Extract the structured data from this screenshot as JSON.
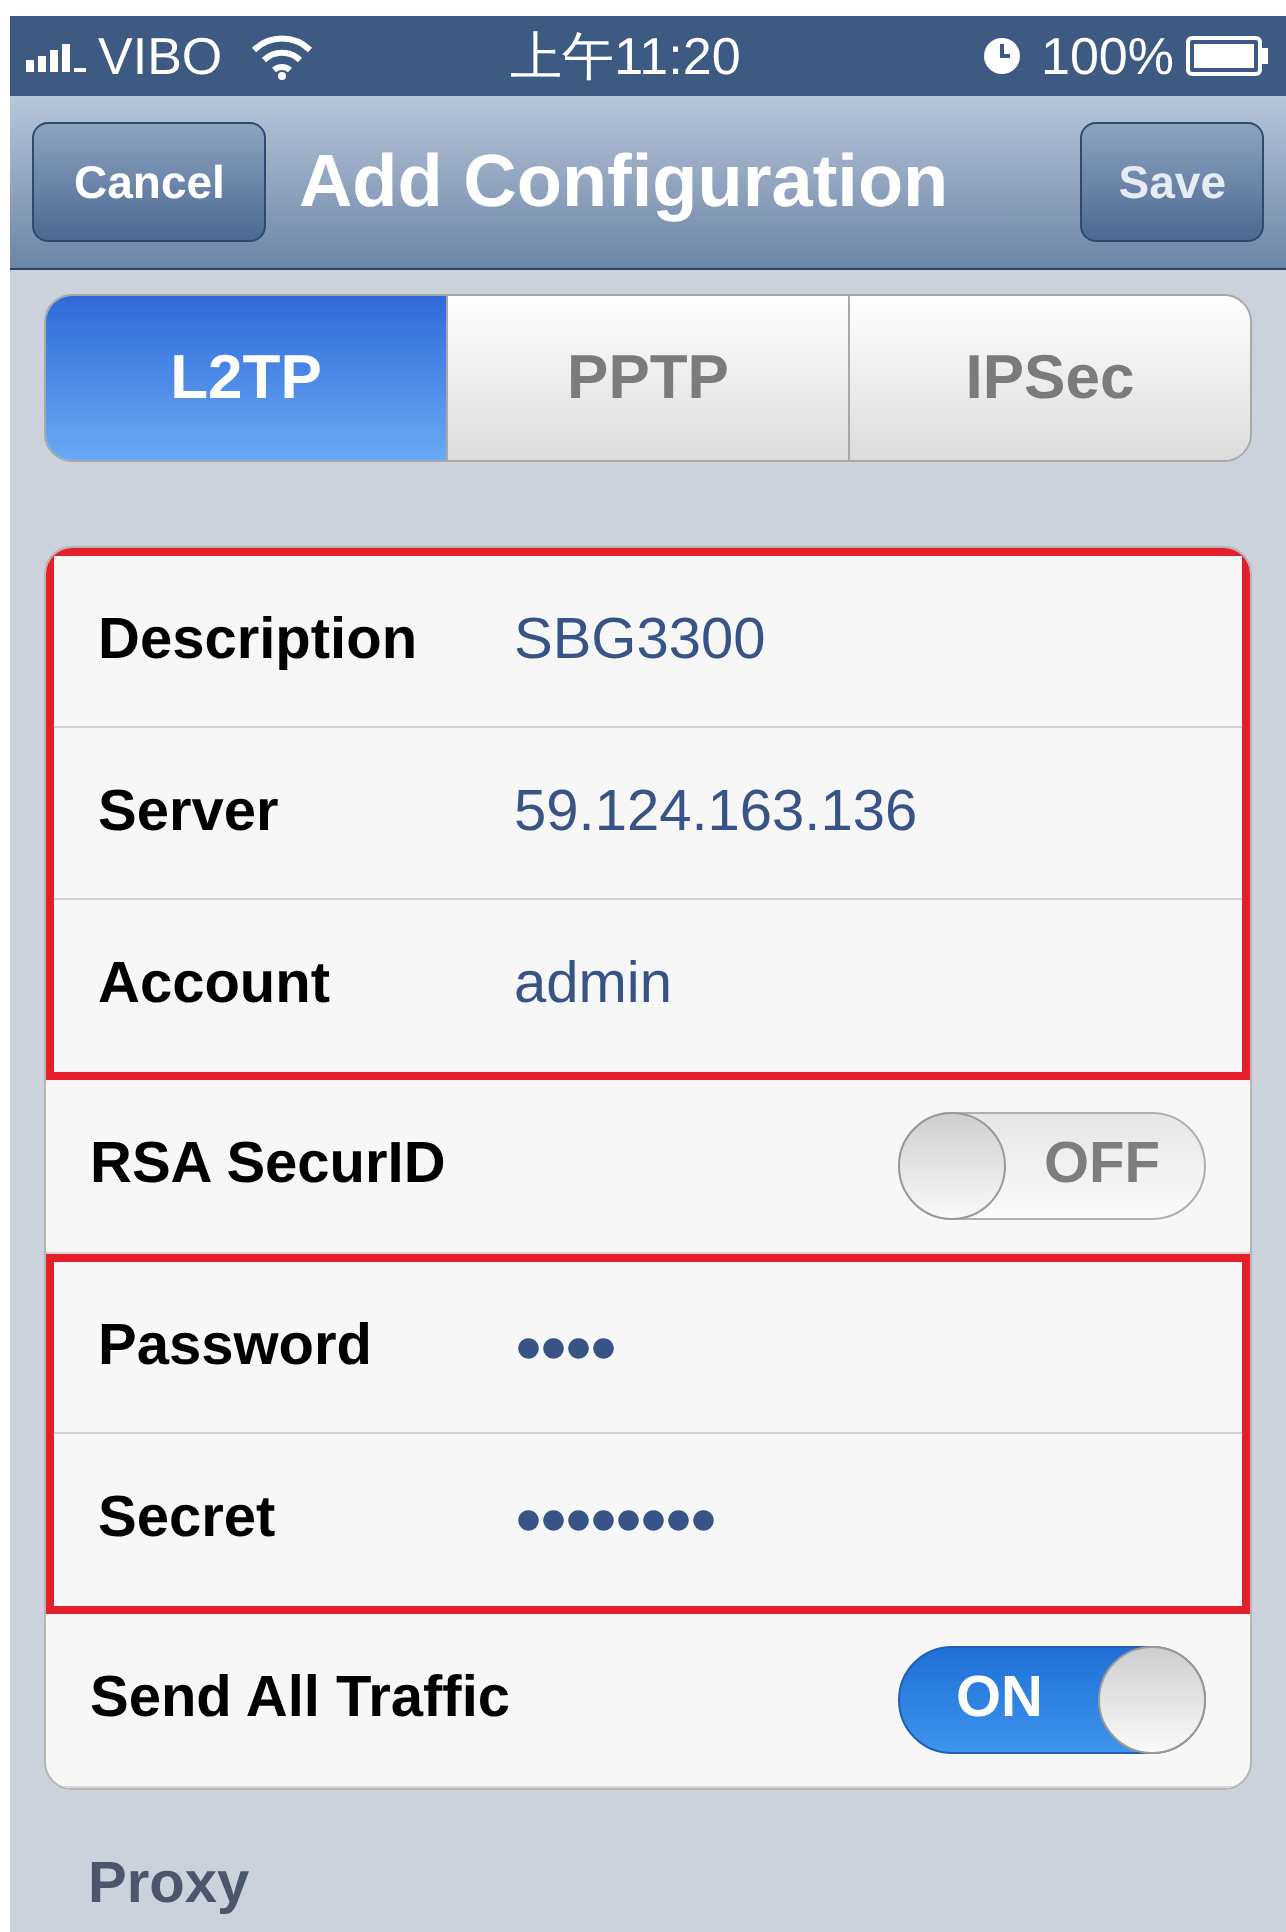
{
  "status_bar": {
    "carrier": "VIBO",
    "time": "上午11:20",
    "battery": "100%"
  },
  "nav_bar": {
    "left_button": "Cancel",
    "title": "Add Configuration",
    "right_button": "Save"
  },
  "tabs": [
    {
      "label": "L2TP",
      "selected": true
    },
    {
      "label": "PPTP",
      "selected": false
    },
    {
      "label": "IPSec",
      "selected": false
    }
  ],
  "sections": [
    {
      "highlighted": true,
      "rows": [
        {
          "kind": "text",
          "label": "Description",
          "value": "SBG3300"
        },
        {
          "kind": "text",
          "label": "Server",
          "value": "59.124.163.136"
        },
        {
          "kind": "text",
          "label": "Account",
          "value": "admin"
        }
      ]
    },
    {
      "highlighted": false,
      "rows": [
        {
          "kind": "switch",
          "label": "RSA SecurID",
          "on": false,
          "switch_text": "OFF"
        }
      ]
    },
    {
      "highlighted": true,
      "rows": [
        {
          "kind": "secret",
          "label": "Password",
          "value": "●●●●"
        },
        {
          "kind": "secret",
          "label": "Secret",
          "value": "●●●●●●●●"
        }
      ]
    },
    {
      "highlighted": false,
      "rows": [
        {
          "kind": "switch",
          "label": "Send All Traffic",
          "on": true,
          "switch_text": "ON"
        }
      ]
    }
  ],
  "footer_header": "Proxy"
}
